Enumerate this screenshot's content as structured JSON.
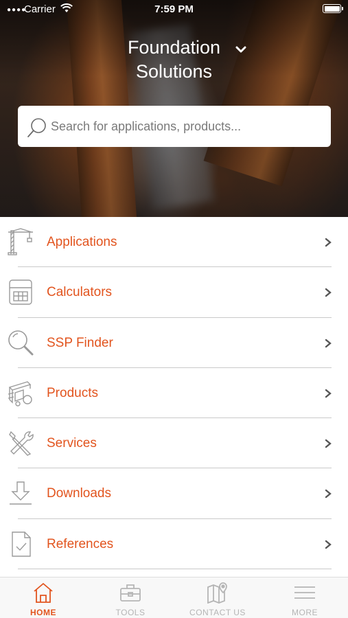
{
  "status_bar": {
    "carrier": "Carrier",
    "time": "7:59 PM"
  },
  "header": {
    "title_line1": "Foundation",
    "title_line2": "Solutions"
  },
  "search": {
    "placeholder": "Search for applications, products..."
  },
  "menu": {
    "items": [
      {
        "label": "Applications",
        "icon": "crane-icon"
      },
      {
        "label": "Calculators",
        "icon": "calculator-icon"
      },
      {
        "label": "SSP Finder",
        "icon": "magnifier-icon"
      },
      {
        "label": "Products",
        "icon": "sheet-piles-icon"
      },
      {
        "label": "Services",
        "icon": "tools-icon"
      },
      {
        "label": "Downloads",
        "icon": "download-icon"
      },
      {
        "label": "References",
        "icon": "document-check-icon"
      }
    ]
  },
  "tabbar": {
    "tabs": [
      {
        "label": "HOME",
        "icon": "home-icon",
        "active": true
      },
      {
        "label": "TOOLS",
        "icon": "toolbox-icon",
        "active": false
      },
      {
        "label": "CONTACT US",
        "icon": "map-pin-icon",
        "active": false
      },
      {
        "label": "MORE",
        "icon": "menu-icon",
        "active": false
      }
    ]
  },
  "colors": {
    "accent": "#e2541e",
    "inactive": "#b5b5b5",
    "divider": "#c9c9c9"
  }
}
